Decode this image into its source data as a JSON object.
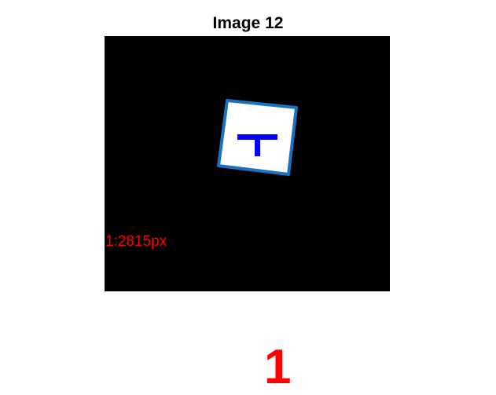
{
  "figure": {
    "title": "Image 12"
  },
  "image_panel": {
    "background_color": "#000000",
    "marker": {
      "fill_color": "#ffffff",
      "outline_color": "#1a73c2",
      "glyph_color": "#0000ff",
      "glyph_icon": "t-shape-icon"
    },
    "measure_label": "1:2815px",
    "measure_color": "#ff0000"
  },
  "result": {
    "number": "1",
    "color": "#ff0000"
  }
}
